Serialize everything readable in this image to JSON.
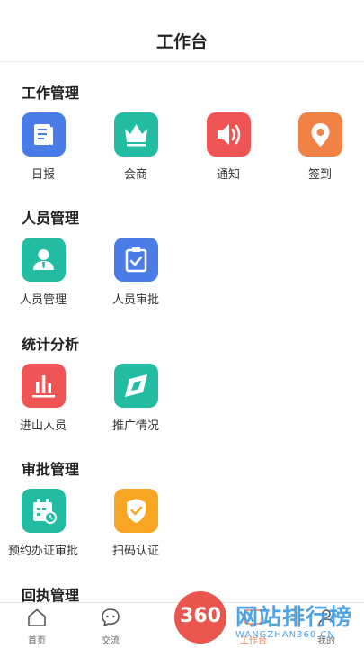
{
  "header": {
    "title": "工作台"
  },
  "sections": [
    {
      "title": "工作管理",
      "items": [
        {
          "label": "日报",
          "icon": "report-icon",
          "color": "#4a7ce8"
        },
        {
          "label": "会商",
          "icon": "crown-icon",
          "color": "#21bca1"
        },
        {
          "label": "通知",
          "icon": "speaker-icon",
          "color": "#ef5555"
        },
        {
          "label": "签到",
          "icon": "location-pin-icon",
          "color": "#f08246"
        }
      ]
    },
    {
      "title": "人员管理",
      "items": [
        {
          "label": "人员管理",
          "icon": "person-icon",
          "color": "#21bca1"
        },
        {
          "label": "人员审批",
          "icon": "clipboard-check-icon",
          "color": "#4a7ce8"
        }
      ]
    },
    {
      "title": "统计分析",
      "items": [
        {
          "label": "进山人员",
          "icon": "bar-chart-icon",
          "color": "#ef5555"
        },
        {
          "label": "推广情况",
          "icon": "compass-icon",
          "color": "#21bca1"
        }
      ]
    },
    {
      "title": "审批管理",
      "items": [
        {
          "label": "预约办证审批",
          "icon": "calendar-clock-icon",
          "color": "#21bca1"
        },
        {
          "label": "扫码认证",
          "icon": "shield-check-icon",
          "color": "#f6a623"
        }
      ]
    },
    {
      "title": "回执管理",
      "items": []
    }
  ],
  "tabbar": {
    "items": [
      {
        "label": "首页",
        "icon": "home-icon"
      },
      {
        "label": "交流",
        "icon": "chat-icon"
      },
      {
        "label": "工作台",
        "icon": "workbench-icon"
      },
      {
        "label": "我的",
        "icon": "user-icon"
      }
    ]
  },
  "watermark": {
    "badge": "360",
    "text": "网站排行榜",
    "subtext": "WANGZHAN360.CN"
  }
}
